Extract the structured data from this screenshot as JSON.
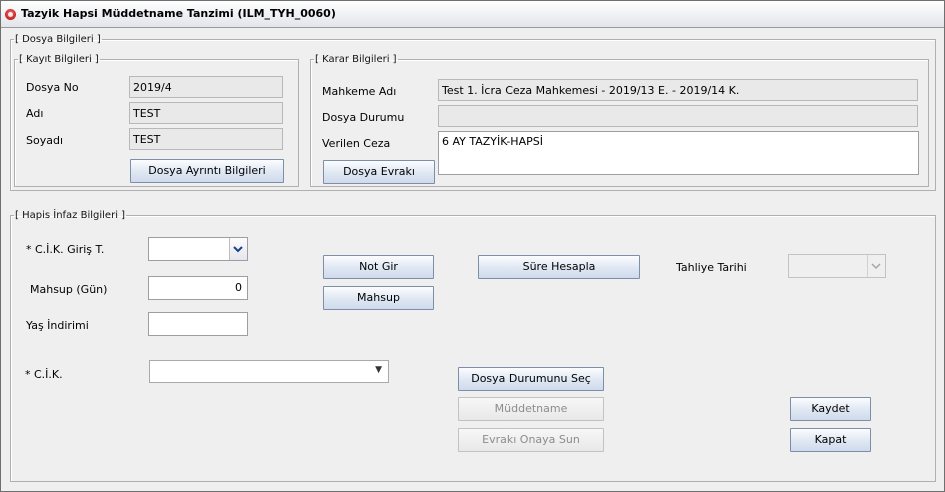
{
  "window": {
    "title": "Tazyik Hapsi Müddetname Tanzimi (ILM_TYH_0060)"
  },
  "dosya_bilgileri": {
    "legend": "[ Dosya Bilgileri ]",
    "kayit": {
      "legend": "[ Kayıt Bilgileri ]",
      "dosya_no_label": "Dosya No",
      "dosya_no": "2019/4",
      "adi_label": "Adı",
      "adi": "TEST",
      "soyadi_label": "Soyadı",
      "soyadi": "TEST",
      "ayrinti_button": "Dosya Ayrıntı Bilgileri"
    },
    "karar": {
      "legend": "[ Karar Bilgileri ]",
      "mahkeme_label": "Mahkeme Adı",
      "mahkeme": "Test 1. İcra Ceza Mahkemesi - 2019/13 E. - 2019/14 K.",
      "durum_label": "Dosya Durumu",
      "durum": "",
      "ceza_label": "Verilen Ceza",
      "ceza": "6 AY TAZYİK-HAPSİ",
      "evraki_button": "Dosya Evrakı"
    }
  },
  "hapis": {
    "legend": "[ Hapis İnfaz Bilgileri ]",
    "cik_giris_label": "* C.İ.K. Giriş T.",
    "cik_giris_value": "",
    "mahsup_label": "Mahsup (Gün)",
    "mahsup_value": "0",
    "yas_label": "Yaş İndirimi",
    "yas_value": "",
    "cik_label": "* C.İ.K.",
    "cik_value": "",
    "not_gir": "Not Gir",
    "mahsup_button": "Mahsup",
    "sure_hesapla": "Süre Hesapla",
    "tahliye_label": "Tahliye Tarihi",
    "tahliye_value": "",
    "dosya_durumu_sec": "Dosya Durumunu Seç",
    "muddetname": "Müddetname",
    "evraki_onaya_sun": "Evrakı Onaya Sun",
    "kaydet": "Kaydet",
    "kapat": "Kapat"
  },
  "icons": {
    "app": "app-logo-icon",
    "chevron": "chevron-down-icon",
    "triangle": "dropdown-triangle-icon"
  }
}
